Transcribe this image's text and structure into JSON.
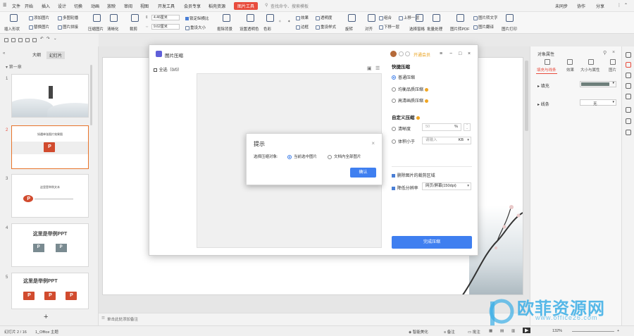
{
  "menubar": {
    "items": [
      "文件",
      "开始",
      "插入",
      "设计",
      "切换",
      "动画",
      "放映",
      "审阅",
      "视图",
      "开发工具",
      "会员专享",
      "稻壳资源",
      "图片工具"
    ],
    "active": "图片工具",
    "search": "查找命令、搜索模板",
    "right": [
      "未同步",
      "协作",
      "分享"
    ]
  },
  "ribbon": {
    "insert_pic": "插入形状",
    "add_pic": "添加图片",
    "replace_pic": "替换图片",
    "multi_pic": "多图轮播",
    "pic_split": "图片拼接",
    "compress": "压缩图片",
    "clarity": "清晰化",
    "crop": "裁剪",
    "height_val": "4.46厘米",
    "width_val": "9.62厘米",
    "lock_ratio": "锁定纵横比",
    "reset_size": "重设大小",
    "cutout": "抠除背景",
    "set_transparent": "设置透明色",
    "color": "色彩",
    "effect": "效果",
    "transparency": "透明度",
    "border": "边框",
    "reset_style": "重设样式",
    "rotate": "旋转",
    "align": "对齐",
    "combine": "组合",
    "bring_fwd": "上移一层",
    "send_back": "下移一层",
    "select_pane": "选择窗格",
    "batch": "批量处理",
    "to_pdf": "图片转PDF",
    "to_text": "图片转文字",
    "translate": "图片翻译",
    "print": "图片打印"
  },
  "leftpane": {
    "tabs": [
      "大纲",
      "幻灯片"
    ],
    "active_tab": "幻灯片",
    "chapter": "第一章",
    "slides": [
      {
        "num": "1",
        "title": ""
      },
      {
        "num": "2",
        "title": "如遇单张图片效果图"
      },
      {
        "num": "3",
        "title": "这里是举例文本"
      },
      {
        "num": "4",
        "title": "这里是举例PPT"
      },
      {
        "num": "5",
        "title": "这里是举例PPT"
      }
    ],
    "add": "+"
  },
  "notes": {
    "placeholder": "单击此处添加备注"
  },
  "compress_win": {
    "title": "图片压缩",
    "vip": "开通会员",
    "select_all": "全选（0/0）",
    "quick_title": "快捷压缩",
    "quick_opts": [
      "普通压缩",
      "均衡品质压缩",
      "高清画质压缩"
    ],
    "quick_selected": 0,
    "custom_title": "自定义压缩",
    "clarity_label": "清晰度",
    "clarity_val": "50",
    "clarity_unit": "%",
    "size_label": "体积小于",
    "size_placeholder": "请输入",
    "size_unit": "KB",
    "crop_label": "删除图片的裁剪区域",
    "res_label": "降低分辨率",
    "res_val": "网页/屏幕(150dpi)",
    "done": "完成压缩"
  },
  "tip": {
    "title": "提示",
    "label": "选择压缩对象:",
    "opt1": "当前选中图片",
    "opt2": "文档内全部图片",
    "ok": "确认"
  },
  "rightpanel": {
    "title": "对象属性",
    "tabs": [
      "填充与线条",
      "效果",
      "大小与属性",
      "图片"
    ],
    "active_tab": "填充与线条",
    "fill": "填充",
    "line": "线条",
    "line_val": "无",
    "fill_color": "#6e7f7b"
  },
  "status": {
    "slide": "幻灯片 2 / 16",
    "theme": "1_Office 主题",
    "beautify": "智能美化",
    "notes": "备注",
    "comment": "批注",
    "zoom": "132%"
  },
  "watermark": {
    "cn": "欧菲资源网",
    "en": "www.office26.com"
  }
}
